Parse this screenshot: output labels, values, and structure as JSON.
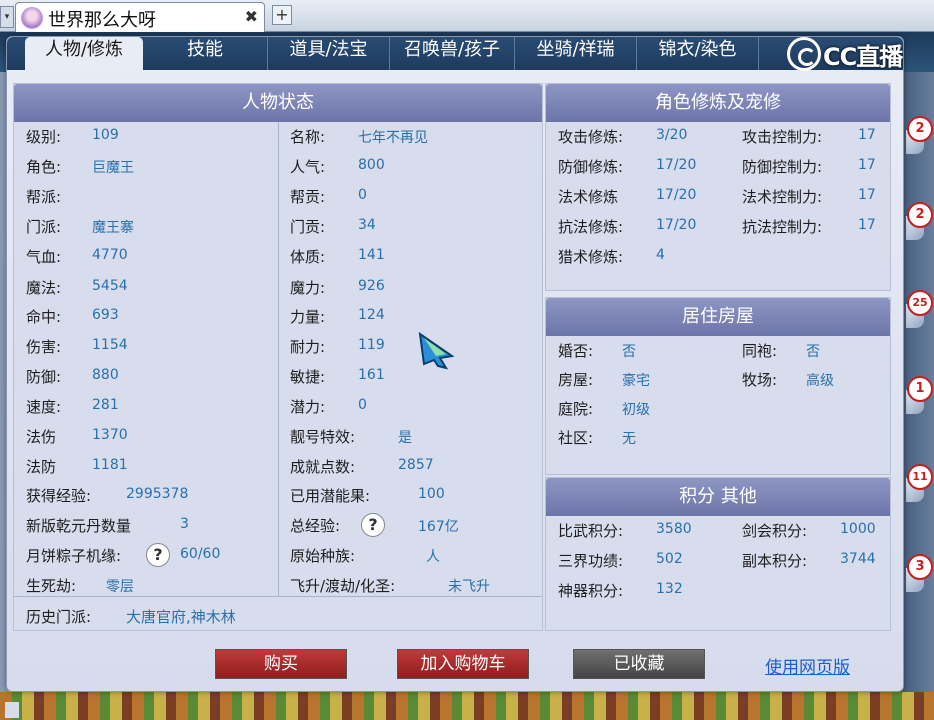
{
  "browser": {
    "tab_title": "世界那么大呀",
    "close_glyph": "✖",
    "new_tab_glyph": "+",
    "dropdown_glyph": "▾"
  },
  "nav": {
    "tabs": [
      "人物/修炼",
      "技能",
      "道具/法宝",
      "召唤兽/孩子",
      "坐骑/祥瑞",
      "锦衣/染色"
    ],
    "active": 0
  },
  "logo": {
    "text": "CC直播"
  },
  "status": {
    "title": "人物状态",
    "left": [
      {
        "label": "级别:",
        "value": "109"
      },
      {
        "label": "角色:",
        "value": "巨魔王"
      },
      {
        "label": "帮派:",
        "value": ""
      },
      {
        "label": "门派:",
        "value": "魔王寨"
      },
      {
        "label": "气血:",
        "value": "4770"
      },
      {
        "label": "魔法:",
        "value": "5454"
      },
      {
        "label": "命中:",
        "value": "693"
      },
      {
        "label": "伤害:",
        "value": "1154"
      },
      {
        "label": "防御:",
        "value": "880"
      },
      {
        "label": "速度:",
        "value": "281"
      },
      {
        "label": "法伤",
        "value": "1370"
      },
      {
        "label": "法防",
        "value": "1181"
      },
      {
        "label": "获得经验:",
        "value": "2995378"
      },
      {
        "label": "新版乾元丹数量",
        "value": "3"
      },
      {
        "label": "月饼粽子机缘:",
        "value": "60/60"
      },
      {
        "label": "生死劫:",
        "value": "零层"
      }
    ],
    "right": [
      {
        "label": "名称:",
        "value": "七年不再见"
      },
      {
        "label": "人气:",
        "value": "800"
      },
      {
        "label": "帮贡:",
        "value": "0"
      },
      {
        "label": "门贡:",
        "value": "34"
      },
      {
        "label": "体质:",
        "value": "141"
      },
      {
        "label": "魔力:",
        "value": "926"
      },
      {
        "label": "力量:",
        "value": "124"
      },
      {
        "label": "耐力:",
        "value": "119"
      },
      {
        "label": "敏捷:",
        "value": "161"
      },
      {
        "label": "潜力:",
        "value": "0"
      },
      {
        "label": "靓号特效:",
        "value": "是"
      },
      {
        "label": "成就点数:",
        "value": "2857"
      },
      {
        "label": "已用潜能果:",
        "value": "100"
      },
      {
        "label": "总经验:",
        "value": "167亿"
      },
      {
        "label": "原始种族:",
        "value": "人"
      },
      {
        "label": "飞升/渡劫/化圣:",
        "value": "未飞升"
      }
    ],
    "history": {
      "label": "历史门派:",
      "value": "大唐官府,神木林"
    },
    "help_glyph": "?"
  },
  "cultivation": {
    "title": "角色修炼及宠修",
    "left": [
      {
        "label": "攻击修炼:",
        "value": "3/20"
      },
      {
        "label": "防御修炼:",
        "value": "17/20"
      },
      {
        "label": "法术修炼",
        "value": "17/20"
      },
      {
        "label": "抗法修炼:",
        "value": "17/20"
      },
      {
        "label": "猎术修炼:",
        "value": "4"
      }
    ],
    "right": [
      {
        "label": "攻击控制力:",
        "value": "17"
      },
      {
        "label": "防御控制力:",
        "value": "17"
      },
      {
        "label": "法术控制力:",
        "value": "17"
      },
      {
        "label": "抗法控制力:",
        "value": "17"
      }
    ]
  },
  "housing": {
    "title": "居住房屋",
    "left": [
      {
        "label": "婚否:",
        "value": "否"
      },
      {
        "label": "房屋:",
        "value": "豪宅"
      },
      {
        "label": "庭院:",
        "value": "初级"
      },
      {
        "label": "社区:",
        "value": "无"
      }
    ],
    "right": [
      {
        "label": "同袍:",
        "value": "否"
      },
      {
        "label": "牧场:",
        "value": "高级"
      }
    ]
  },
  "points": {
    "title": "积分 其他",
    "left": [
      {
        "label": "比武积分:",
        "value": "3580"
      },
      {
        "label": "三界功绩:",
        "value": "502"
      },
      {
        "label": "神器积分:",
        "value": "132"
      }
    ],
    "right": [
      {
        "label": "剑会积分:",
        "value": "1000"
      },
      {
        "label": "副本积分:",
        "value": "3744"
      }
    ]
  },
  "buttons": {
    "buy": "购买",
    "add_cart": "加入购物车",
    "favorited": "已收藏",
    "web_version": "使用网页版"
  },
  "side_badges": [
    "2",
    "2",
    "25",
    "1",
    "11",
    "3"
  ],
  "colors": {
    "value_blue": "#2a6fa8",
    "header_purple": "#7a82b6",
    "buy_red": "#a82828",
    "fav_gray": "#5a5a5a",
    "link_blue": "#1a5fd0"
  }
}
